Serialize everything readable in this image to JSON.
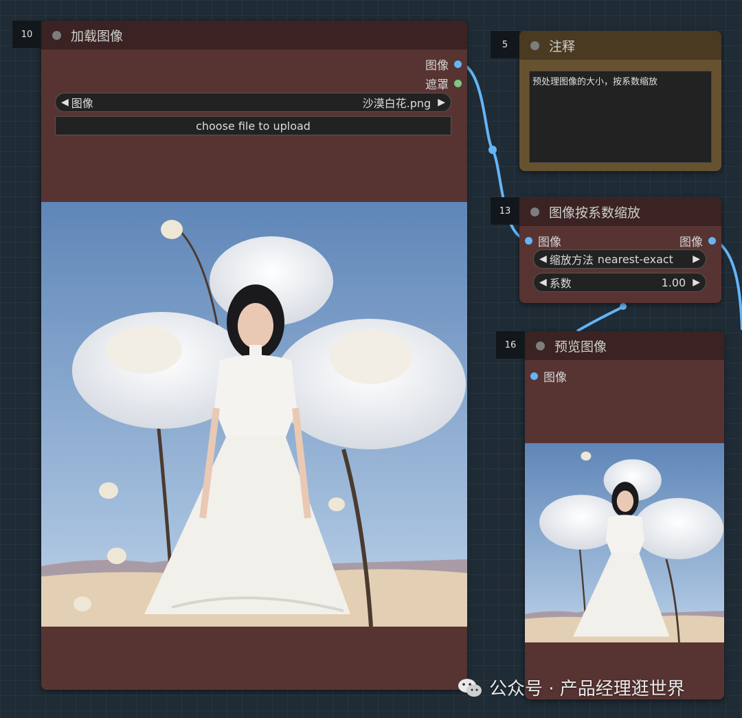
{
  "nodes": {
    "load_image": {
      "id": "10",
      "title": "加载图像",
      "outputs": [
        "图像",
        "遮罩"
      ],
      "image_widget": {
        "label": "图像",
        "value": "沙漠白花.png"
      },
      "upload_label": "choose file to upload"
    },
    "note": {
      "id": "5",
      "title": "注释",
      "text": "预处理图像的大小，按系数缩放"
    },
    "scale": {
      "id": "13",
      "title": "图像按系数缩放",
      "input": "图像",
      "output": "图像",
      "method": {
        "label": "缩放方法",
        "value": "nearest-exact"
      },
      "factor": {
        "label": "系数",
        "value": "1.00"
      }
    },
    "preview": {
      "id": "16",
      "title": "预览图像",
      "input": "图像"
    }
  },
  "watermark": "公众号 · 产品经理逛世界",
  "colors": {
    "node_body": "#573432",
    "node_header": "#3a2322",
    "wire": "#64b5f6",
    "note_body": "#675230",
    "note_header": "#4a3a22"
  }
}
